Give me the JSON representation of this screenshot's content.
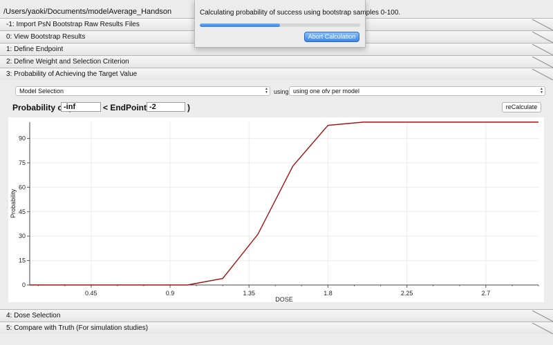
{
  "path": "/Users/yaoki/Documents/modelAverage_Handson",
  "sections_top": [
    "-1: Import PsN Bootstrap Raw Results Files",
    "0: View Bootstrap Results",
    "1: Define Endpoint",
    "2: Define Weight and Selection Criterion",
    "3: Probability of Achieving the Target Value"
  ],
  "sections_bottom": [
    "4: Dose Selection",
    "5: Compare with Truth (For simulation studies)"
  ],
  "dialog": {
    "message": "Calculating probability of success using bootstrap samples 0-100.",
    "progress": 0.5,
    "abort_label": "Abort Calculation"
  },
  "controls": {
    "method_select": "Model Selection",
    "using_label": "using",
    "ofv_select": "using one ofv per model",
    "prob_label": "Probability of (",
    "lower_value": "-inf",
    "endpoint_label": "< EndPoint <",
    "upper_value": "-2",
    "close_paren": ")",
    "recalc_label": "reCalculate"
  },
  "colors": {
    "line": "#a01010",
    "progress": "#3a86e6",
    "primary_button": "#3b86e6"
  },
  "chart_data": {
    "type": "line",
    "xlabel": "DOSE",
    "ylabel": "Probability",
    "xlim": [
      0.1,
      3.0
    ],
    "ylim": [
      0,
      100
    ],
    "x_ticks": [
      "0.45",
      "0.9",
      "1.35",
      "1.8",
      "2.25",
      "2.7"
    ],
    "y_ticks": [
      "0",
      "15",
      "30",
      "45",
      "60",
      "75",
      "90"
    ],
    "grid": true,
    "series": [
      {
        "x": [
          0.1,
          0.3,
          0.5,
          0.7,
          0.9,
          1.0,
          1.2,
          1.4,
          1.6,
          1.8,
          2.0,
          2.2,
          2.4,
          2.6,
          2.8,
          3.0
        ],
        "values": [
          0,
          0,
          0,
          0,
          0,
          0,
          4,
          31,
          73,
          98,
          100,
          100,
          100,
          100,
          100,
          100
        ]
      }
    ]
  }
}
